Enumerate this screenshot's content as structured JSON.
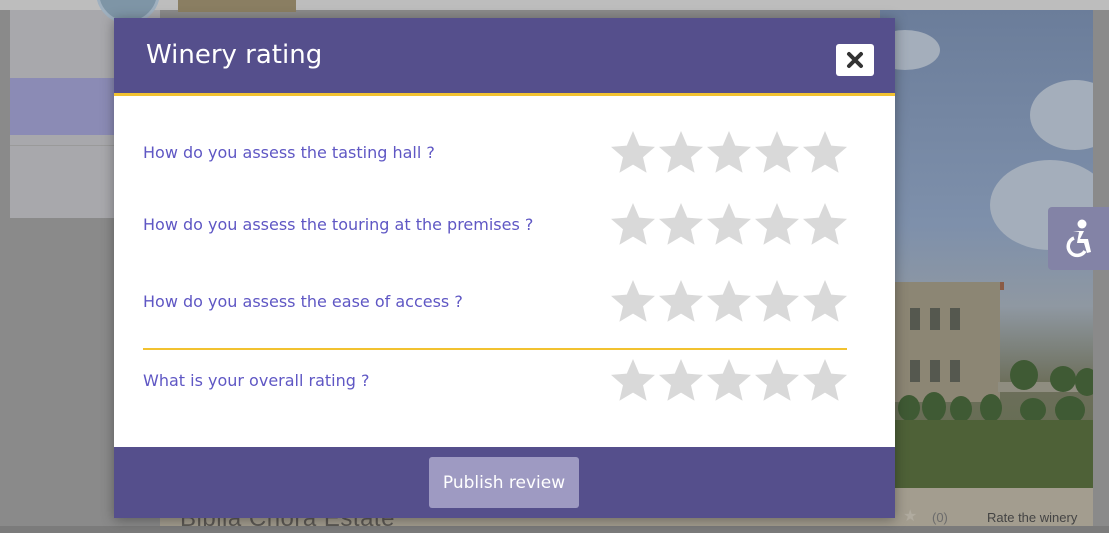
{
  "modal": {
    "title": "Winery rating",
    "questions": [
      {
        "label": "How do you assess the tasting hall ?",
        "rating": 0,
        "max": 5
      },
      {
        "label": "How do you assess the touring at the premises ?",
        "rating": 0,
        "max": 5
      },
      {
        "label": "How do you assess the ease of access ?",
        "rating": 0,
        "max": 5
      }
    ],
    "overall": {
      "label": "What is your overall rating ?",
      "rating": 0,
      "max": 5
    },
    "publish_label": "Publish review"
  },
  "background": {
    "winery_name": "Biblia Chora Estate",
    "rating_count": "(0)",
    "rate_link": "Rate the winery"
  },
  "icons": {
    "close": "close-icon",
    "accessibility": "accessibility-icon",
    "star": "star-icon"
  },
  "colors": {
    "header": "#554f8c",
    "accent": "#f2c230",
    "question_text": "#5f57c4",
    "star_empty": "#d9d9d9",
    "publish_button": "#9e9ac2"
  }
}
